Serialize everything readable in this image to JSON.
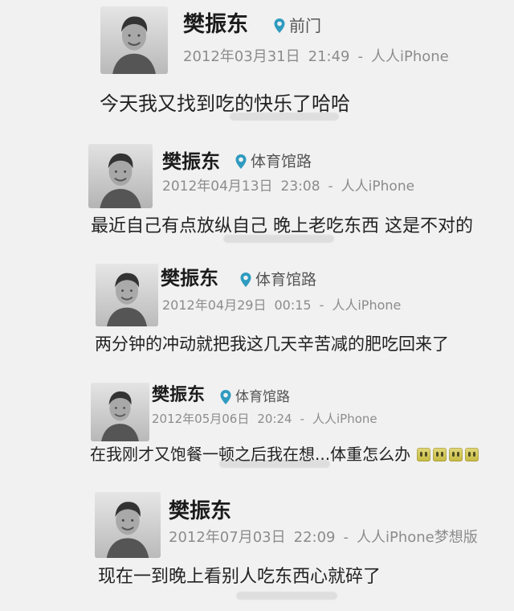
{
  "feed": {
    "posts": [
      {
        "author": "樊振东",
        "location": "前门",
        "date": "2012年03月31日",
        "time": "21:49",
        "separator": "-",
        "source": "人人iPhone",
        "message": "今天我又找到吃的快乐了哈哈"
      },
      {
        "author": "樊振东",
        "location": "体育馆路",
        "date": "2012年04月13日",
        "time": "23:08",
        "separator": "-",
        "source": "人人iPhone",
        "message": "最近自己有点放纵自己 晚上老吃东西 这是不对的"
      },
      {
        "author": "樊振东",
        "location": "体育馆路",
        "date": "2012年04月29日",
        "time": "00:15",
        "separator": "-",
        "source": "人人iPhone",
        "message": "两分钟的冲动就把我这几天辛苦减的肥吃回来了"
      },
      {
        "author": "樊振东",
        "location": "体育馆路",
        "date": "2012年05月06日",
        "time": "20:24",
        "separator": "-",
        "source": "人人iPhone",
        "message": "在我刚才又饱餐一顿之后我在想...体重怎么办",
        "emoji_count": 4
      },
      {
        "author": "樊振东",
        "location": "",
        "date": "2012年07月03日",
        "time": "22:09",
        "separator": "-",
        "source": "人人iPhone梦想版",
        "message": "现在一到晚上看别人吃东西心就碎了"
      }
    ]
  },
  "icons": {
    "avatar": "avatar",
    "location": "location-pin-icon",
    "emoji": "crying-emoji-icon"
  },
  "colors": {
    "background": "#f1f1f1",
    "text": "#161616",
    "meta": "#8c8c8c",
    "pin": "#2f9bc0"
  }
}
